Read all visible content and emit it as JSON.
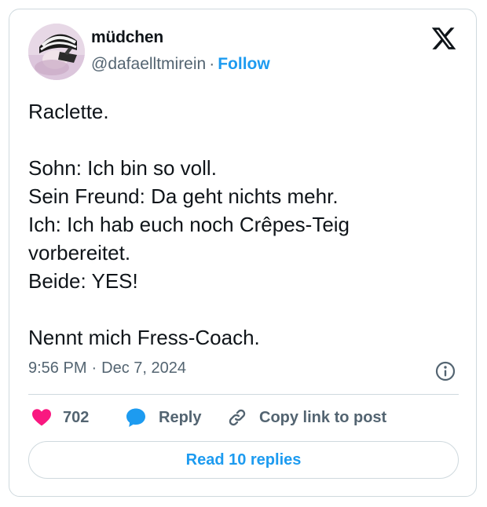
{
  "author": {
    "display_name": "müdchen",
    "handle": "@dafaelltmirein",
    "separator": "·",
    "follow_label": "Follow"
  },
  "tweet": {
    "lines": [
      "Raclette.",
      "",
      "Sohn: Ich bin so voll.",
      "Sein Freund: Da geht nichts mehr.",
      "Ich: Ich hab euch noch Crêpes-Teig",
      "vorbereitet.",
      "Beide: YES!",
      "",
      "Nennt mich Fress-Coach."
    ],
    "time": "9:56 PM",
    "separator": "·",
    "date": "Dec 7, 2024"
  },
  "actions": {
    "like_count": "702",
    "reply_label": "Reply",
    "copy_link_label": "Copy link to post",
    "read_replies_label": "Read 10 replies"
  },
  "icons": {
    "brand": "x-logo-icon",
    "info": "info-icon",
    "like": "heart-icon",
    "reply": "speech-bubble-icon",
    "copy": "link-icon"
  },
  "colors": {
    "accent": "#1d9bf0",
    "heart": "#f91880",
    "secondary_text": "#536471",
    "border": "#cfd9de",
    "text": "#0f1419"
  }
}
